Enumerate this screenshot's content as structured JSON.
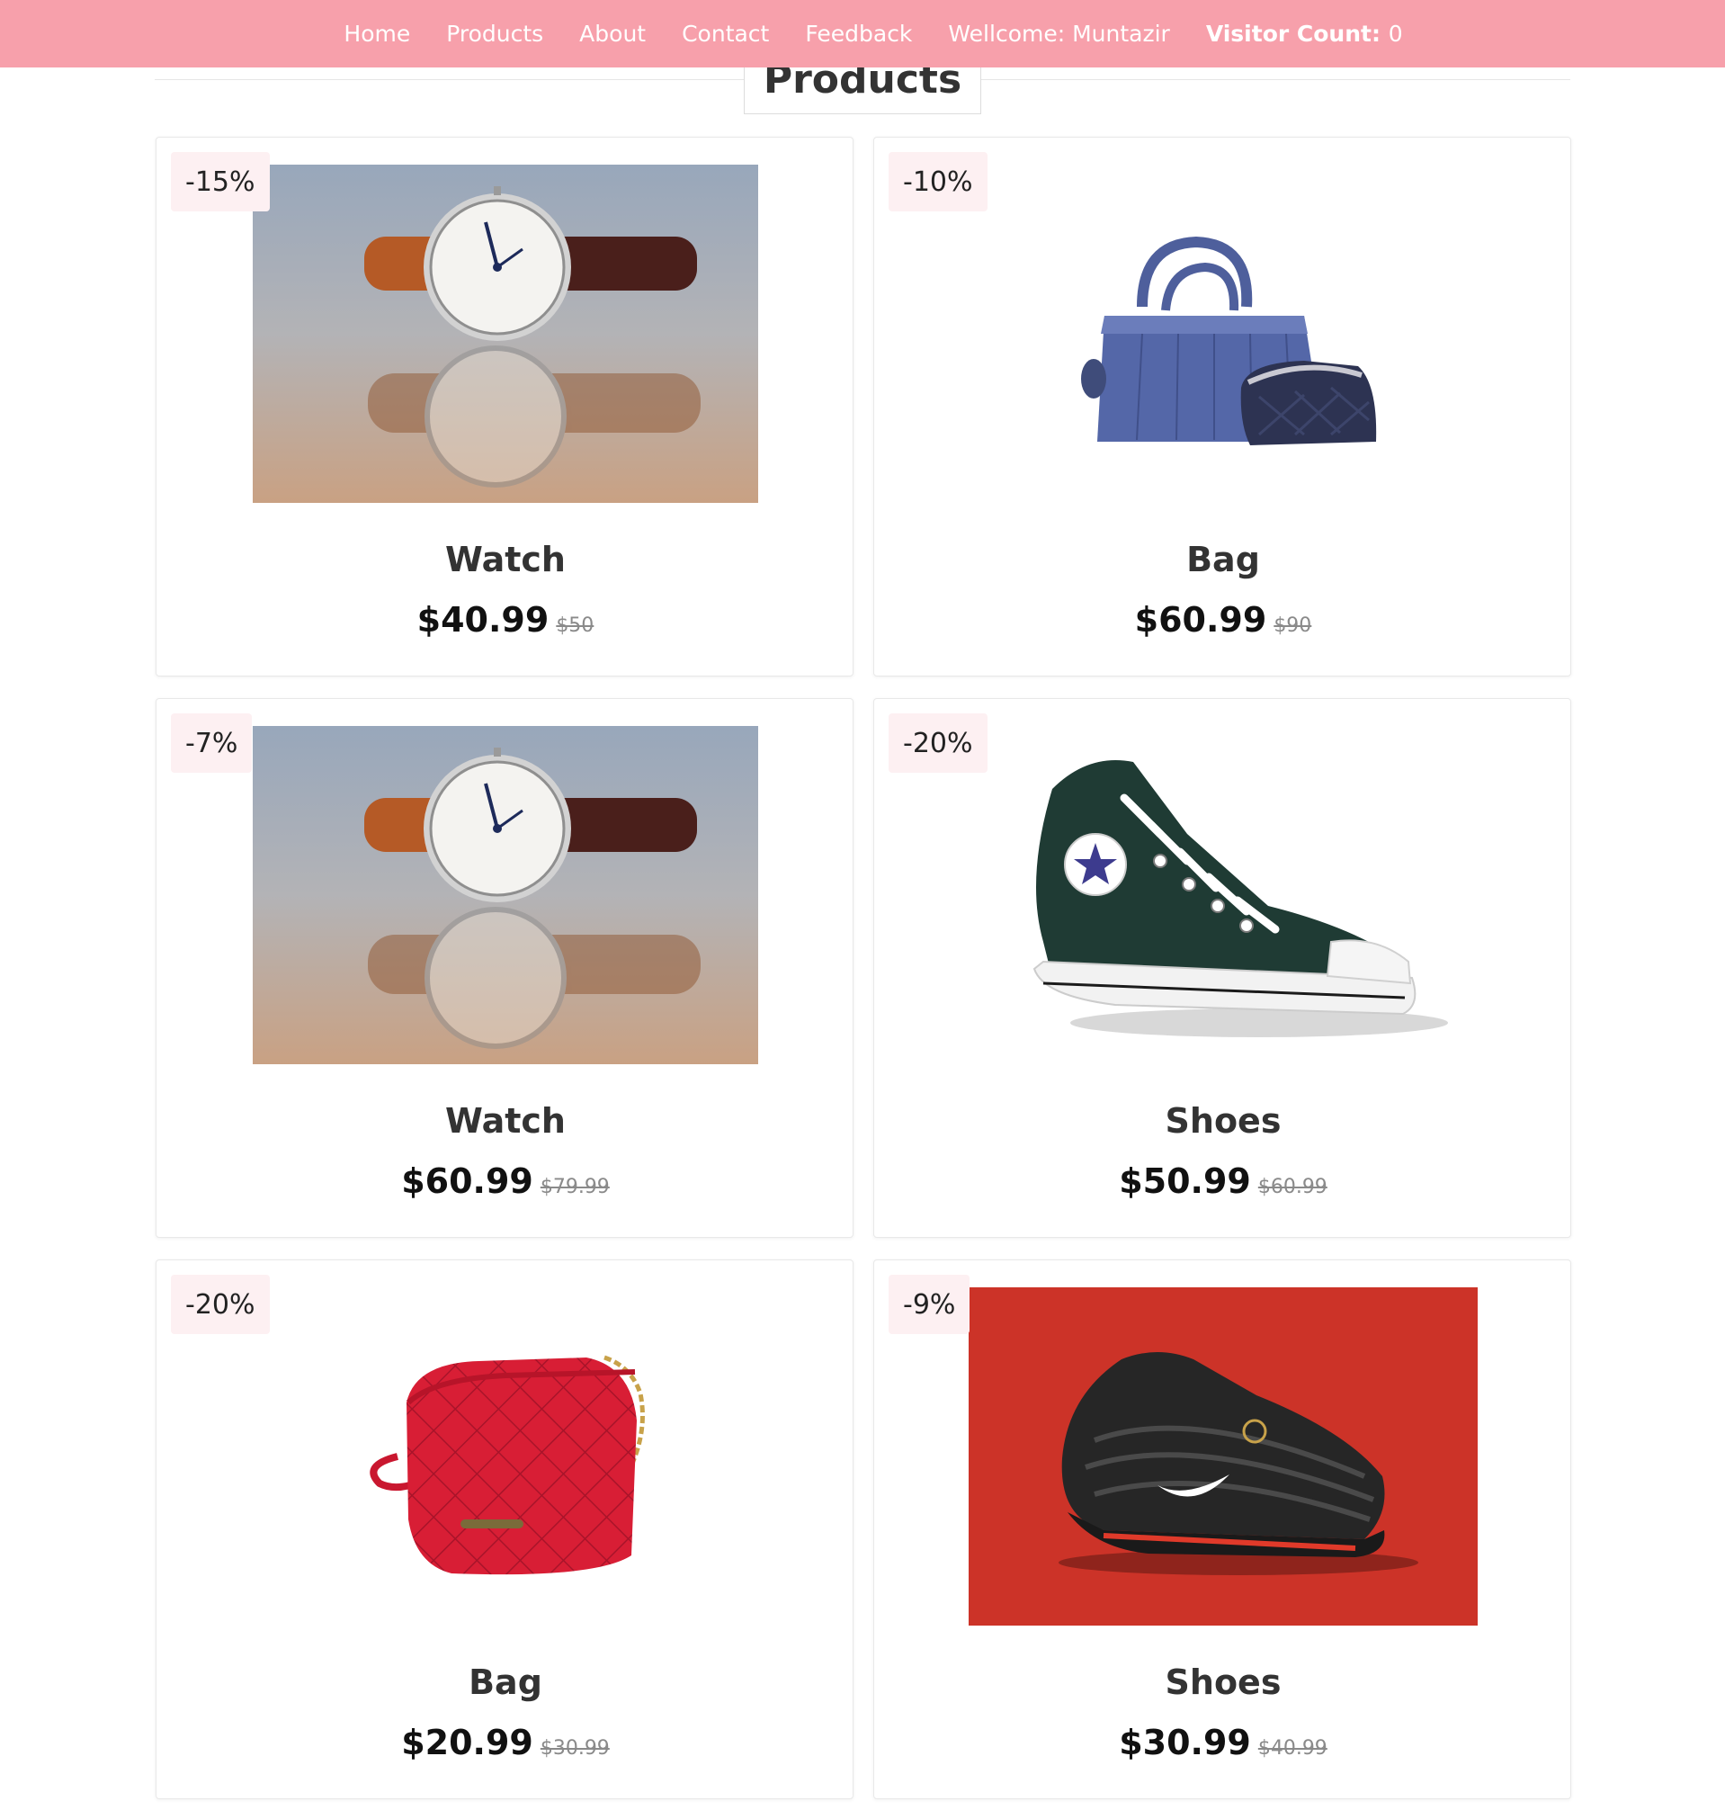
{
  "nav": {
    "home": "Home",
    "products": "Products",
    "about": "About",
    "contact": "Contact",
    "feedback": "Feedback",
    "welcome": "Wellcome: Muntazir",
    "visitor_label": "Visitor Count:",
    "visitor_count": "0"
  },
  "section": {
    "title": "Products"
  },
  "colors": {
    "nav_bg": "#f7a0ab",
    "badge_bg": "#fdf0f2"
  },
  "products": [
    {
      "discount": "-15%",
      "name": "Watch",
      "price": "$40.99",
      "old_price": "$50",
      "image": "watch-photo"
    },
    {
      "discount": "-10%",
      "name": "Bag",
      "price": "$60.99",
      "old_price": "$90",
      "image": "blue-bag-photo"
    },
    {
      "discount": "-7%",
      "name": "Watch",
      "price": "$60.99",
      "old_price": "$79.99",
      "image": "watch-photo"
    },
    {
      "discount": "-20%",
      "name": "Shoes",
      "price": "$50.99",
      "old_price": "$60.99",
      "image": "green-sneaker-photo"
    },
    {
      "discount": "-20%",
      "name": "Bag",
      "price": "$20.99",
      "old_price": "$30.99",
      "image": "red-bag-photo"
    },
    {
      "discount": "-9%",
      "name": "Shoes",
      "price": "$30.99",
      "old_price": "$40.99",
      "image": "black-sneaker-photo"
    }
  ]
}
